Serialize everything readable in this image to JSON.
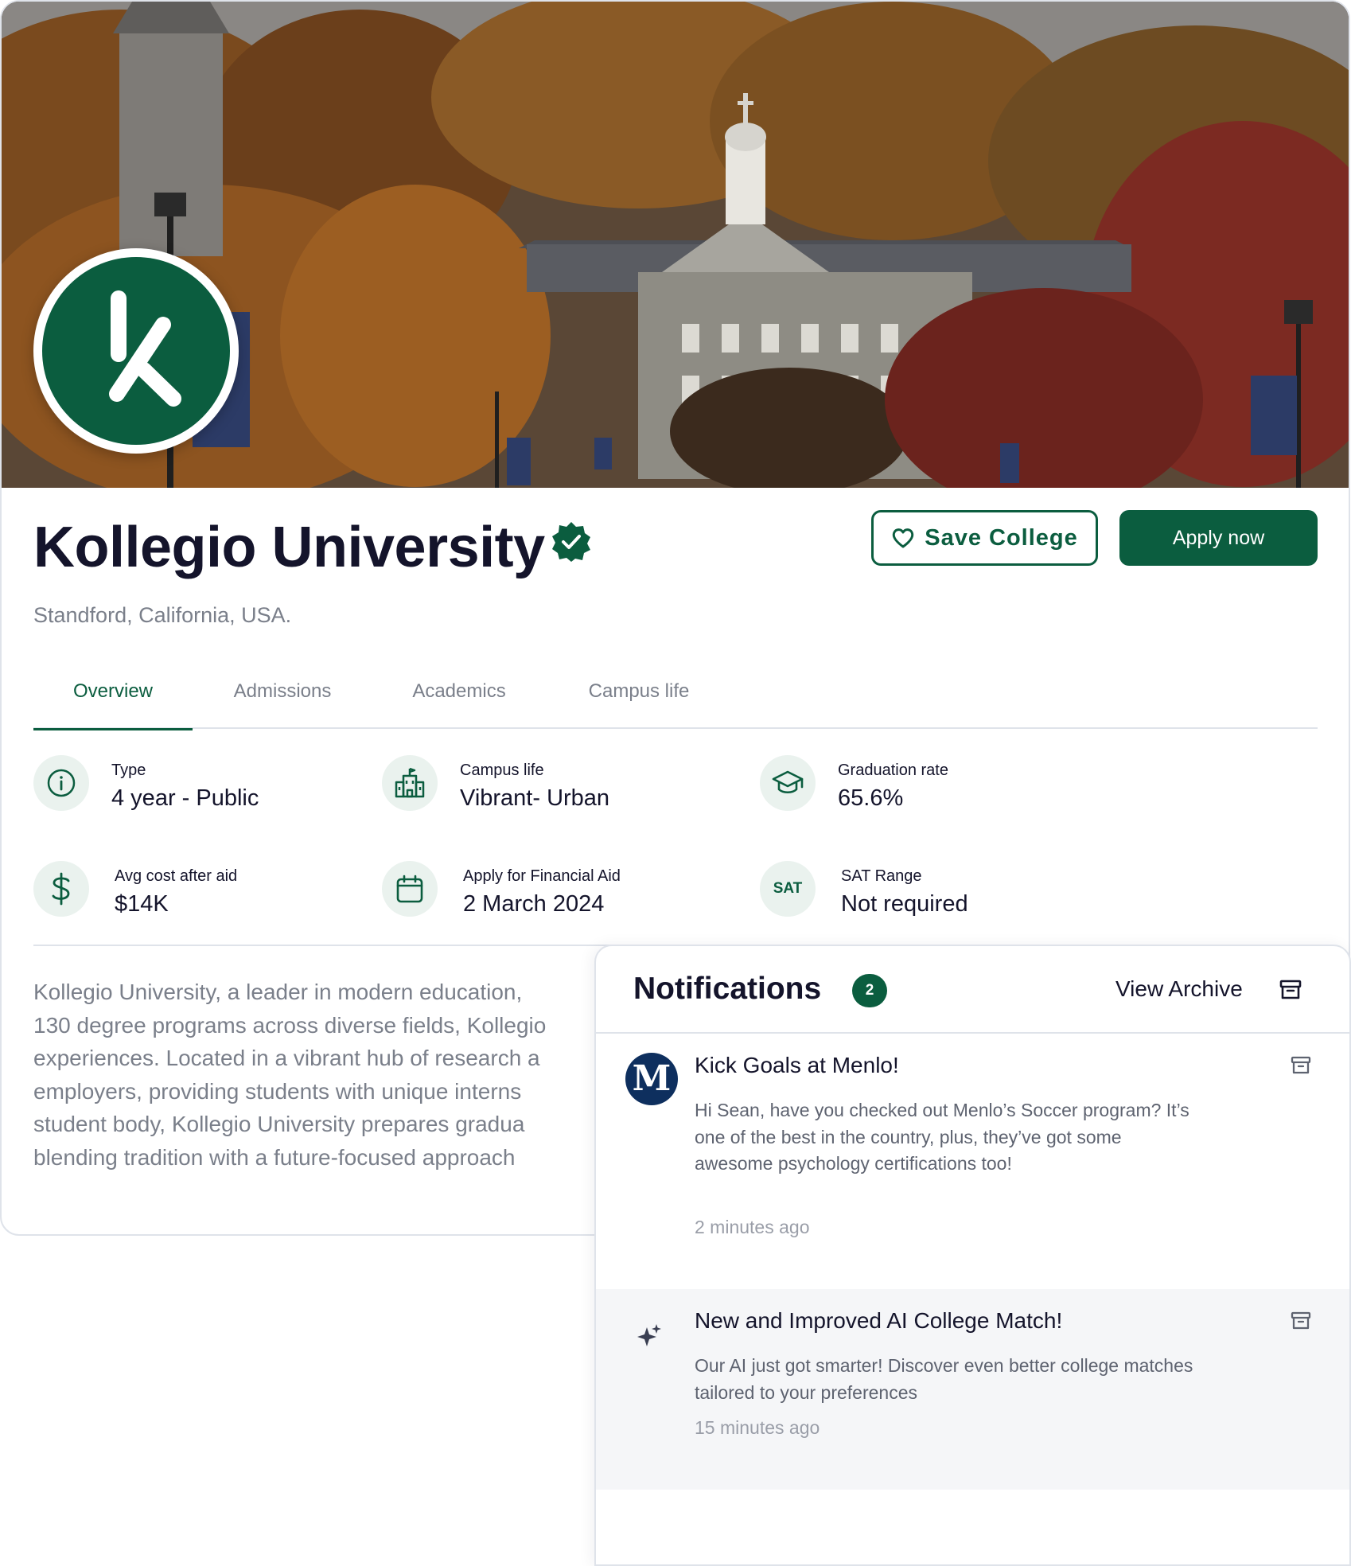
{
  "college": {
    "name": "Kollegio University",
    "location": "Standford, California, USA.",
    "verified_icon": "verified-badge-icon",
    "logo_icon": "kollegio-logo"
  },
  "actions": {
    "save_label": "Save College",
    "apply_label": "Apply now"
  },
  "tabs": [
    {
      "label": "Overview",
      "active": true
    },
    {
      "label": "Admissions",
      "active": false
    },
    {
      "label": "Academics",
      "active": false
    },
    {
      "label": "Campus life",
      "active": false
    }
  ],
  "stats": [
    {
      "label": "Type",
      "value": "4 year - Public",
      "icon": "info-icon"
    },
    {
      "label": "Campus life",
      "value": "Vibrant- Urban",
      "icon": "campus-building-icon"
    },
    {
      "label": "Graduation rate",
      "value": "65.6%",
      "icon": "graduation-cap-icon"
    },
    {
      "label": "Avg cost after aid",
      "value": "$14K",
      "icon": "dollar-icon"
    },
    {
      "label": "Apply for Financial Aid",
      "value": "2 March 2024",
      "icon": "calendar-icon"
    },
    {
      "label": "SAT Range",
      "value": "Not required",
      "icon": "sat-badge",
      "icon_text": "SAT"
    }
  ],
  "description": [
    "Kollegio University, a leader in modern education,",
    "130 degree programs across diverse fields, Kollegio",
    "experiences. Located in a vibrant hub of research a",
    "employers, providing students with unique interns",
    "student body, Kollegio University prepares gradua",
    "blending tradition with a future-focused approach"
  ],
  "notifications": {
    "title": "Notifications",
    "count": "2",
    "view_archive_label": "View Archive",
    "items": [
      {
        "avatar_letter": "M",
        "title": "Kick Goals at Menlo!",
        "body": "Hi Sean, have you checked out Menlo’s Soccer program? It’s one of the best in the country, plus, they’ve got some awesome psychology certifications too!",
        "time": "2 minutes ago"
      },
      {
        "icon": "sparkle-icon",
        "title": "New and Improved AI College Match!",
        "body": "Our AI just got smarter! Discover even better college matches tailored to your preferences",
        "time": "15 minutes ago"
      }
    ]
  },
  "colors": {
    "brand_green": "#0b5d3f",
    "text_dark": "#14142b",
    "text_muted": "#7a7f8a",
    "border": "#dfe3ea",
    "icon_bg": "#eaf2ee"
  }
}
